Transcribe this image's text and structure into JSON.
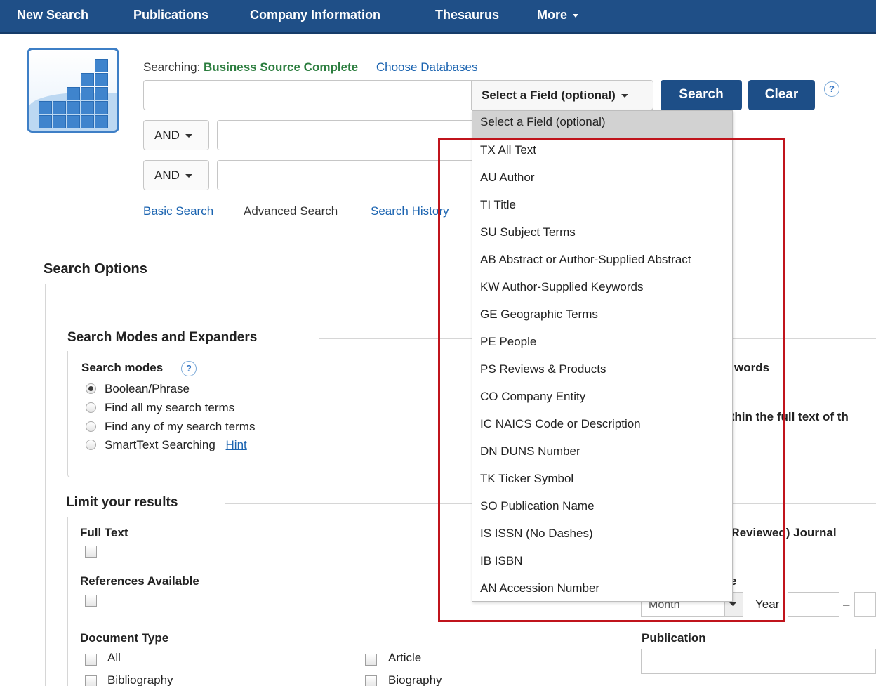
{
  "nav": {
    "items": [
      "New Search",
      "Publications",
      "Company Information",
      "Thesaurus",
      "More"
    ]
  },
  "search": {
    "searching_label": "Searching:",
    "database": "Business Source Complete",
    "choose_databases": "Choose Databases",
    "field_select_label": "Select a Field (optional)",
    "search_button": "Search",
    "clear_button": "Clear",
    "help": "?",
    "bool_rows": [
      "AND",
      "AND"
    ]
  },
  "links": {
    "basic_search": "Basic Search",
    "advanced_search": "Advanced Search",
    "search_history": "Search History"
  },
  "options": {
    "title": "Search Options",
    "modes_section": "Search Modes and Expanders",
    "modes_label": "Search modes",
    "modes": [
      {
        "label": "Boolean/Phrase",
        "selected": true
      },
      {
        "label": "Find all my search terms",
        "selected": false
      },
      {
        "label": "Find any of my search terms",
        "selected": false
      },
      {
        "label": "SmartText Searching",
        "selected": false
      }
    ],
    "hint": "Hint",
    "right_partial_1": "words",
    "right_partial_2": "ithin the full text of th"
  },
  "limits": {
    "title": "Limit your results",
    "full_text": "Full Text",
    "references": "References Available",
    "document_type": "Document Type",
    "doc_types_col1": [
      "All",
      "Bibliography"
    ],
    "doc_types_col2": [
      "Article",
      "Biography"
    ],
    "right_partial_journal": "r Reviewed) Journal",
    "right_partial_date": "e",
    "month": "Month",
    "year": "Year",
    "dash": "–",
    "publication": "Publication"
  },
  "dropdown": {
    "selected": "Select a Field (optional)",
    "items": [
      "TX All Text",
      "AU Author",
      "TI Title",
      "SU Subject Terms",
      "AB Abstract or Author-Supplied Abstract",
      "KW Author-Supplied Keywords",
      "GE Geographic Terms",
      "PE People",
      "PS Reviews & Products",
      "CO Company Entity",
      "IC NAICS Code or Description",
      "DN DUNS Number",
      "TK Ticker Symbol",
      "SO Publication Name",
      "IS ISSN (No Dashes)",
      "IB ISBN",
      "AN Accession Number"
    ]
  },
  "colors": {
    "nav_bg": "#1f4f87",
    "button_bg": "#1d4e87",
    "database_green": "#2b7d3e",
    "link_blue": "#1a63b0",
    "highlight_red": "#c0141c"
  }
}
